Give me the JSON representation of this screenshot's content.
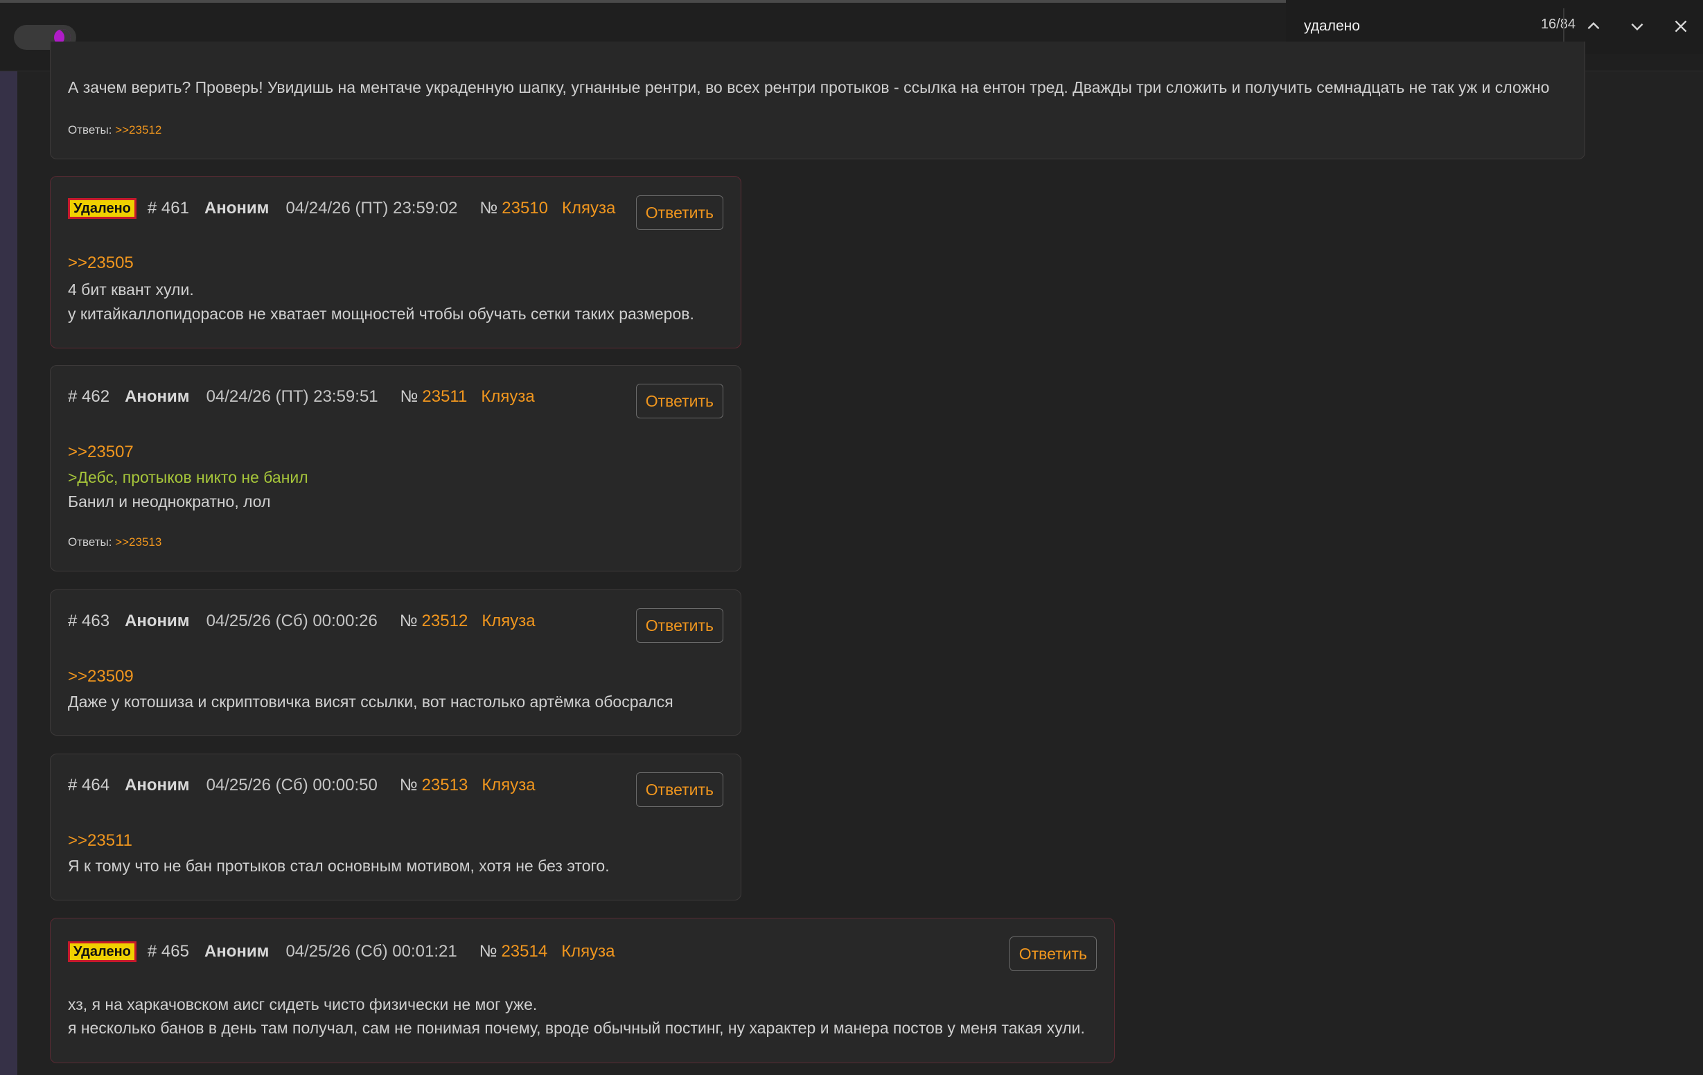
{
  "find_bar": {
    "query": "удалено",
    "count": "16/84"
  },
  "top_post": {
    "text": "А зачем верить? Проверь! Увидишь на ментаче украденную шапку, угнанные рентри, во всех рентри протыков - ссылка на ентон тред. Дважды три сложить и получить семнадцать не так уж и сложно",
    "answers_label": "Ответы:",
    "answers_link": ">>23512"
  },
  "posts": [
    {
      "deleted_label": "Удалено",
      "num": "# 461",
      "author": "Аноним",
      "date": "04/24/26 (ПТ) 23:59:02",
      "no_label": "№",
      "id": "23510",
      "complaint": "Кляуза",
      "reply": "Ответить",
      "quote": ">>23505",
      "lines": [
        "4 бит квант хули.",
        "у китайкаллопидорасов не хватает мощностей чтобы обучать сетки таких размеров."
      ]
    },
    {
      "num": "# 462",
      "author": "Аноним",
      "date": "04/24/26 (ПТ) 23:59:51",
      "no_label": "№",
      "id": "23511",
      "complaint": "Кляуза",
      "reply": "Ответить",
      "quote": ">>23507",
      "greentext": ">Дебс, протыков никто не банил",
      "lines": [
        "Банил и неоднократно, лол"
      ],
      "answers_label": "Ответы:",
      "answers_link": ">>23513"
    },
    {
      "num": "# 463",
      "author": "Аноним",
      "date": "04/25/26 (Сб) 00:00:26",
      "no_label": "№",
      "id": "23512",
      "complaint": "Кляуза",
      "reply": "Ответить",
      "quote": ">>23509",
      "lines": [
        "Даже у котошиза и скриптовичка висят ссылки, вот настолько артёмка обосрался"
      ]
    },
    {
      "num": "# 464",
      "author": "Аноним",
      "date": "04/25/26 (Сб) 00:00:50",
      "no_label": "№",
      "id": "23513",
      "complaint": "Кляуза",
      "reply": "Ответить",
      "quote": ">>23511",
      "lines": [
        "Я к тому что не бан протыков стал основным мотивом, хотя не без этого."
      ]
    },
    {
      "deleted_label": "Удалено",
      "num": "# 465",
      "author": "Аноним",
      "date": "04/25/26 (Сб) 00:01:21",
      "no_label": "№",
      "id": "23514",
      "complaint": "Кляуза",
      "reply": "Ответить",
      "lines": [
        "хз, я на харкачовском аисг сидеть чисто физически не мог уже.",
        "я несколько банов в день там получал, сам не понимая почему, вроде обычный постинг, ну характер и манера постов у меня такая хули."
      ]
    }
  ],
  "colors": {
    "background": "#222222",
    "post_bg": "#282828",
    "accent_orange": "#f0961e",
    "greentext": "#a6c53a",
    "deleted_badge_bg": "#f0d000",
    "deleted_badge_border": "#c61a2a"
  }
}
